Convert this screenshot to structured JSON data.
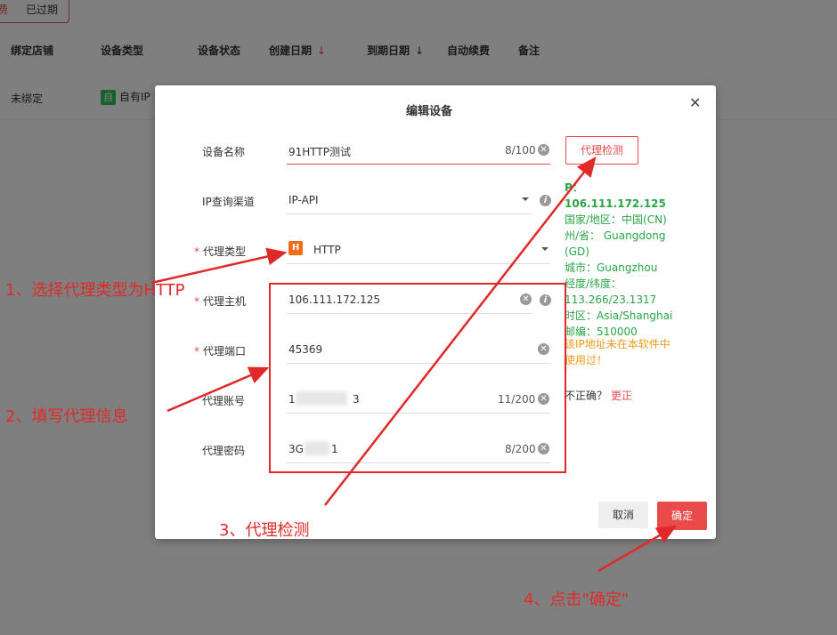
{
  "background": {
    "tabs": [
      "费",
      "已过期"
    ],
    "columns": [
      "绑定店铺",
      "设备类型",
      "设备状态",
      "创建日期",
      "到期日期",
      "自动续费",
      "备注"
    ],
    "row": {
      "shop": "未绑定",
      "type_badge": "自",
      "type_text": "自有IP"
    }
  },
  "modal": {
    "title": "编辑设备",
    "fields": {
      "name": {
        "label": "设备名称",
        "value": "91HTTP测试",
        "count": "8/100"
      },
      "channel": {
        "label": "IP查询渠道",
        "value": "IP-API"
      },
      "proxy_type": {
        "label": "代理类型",
        "value": "HTTP",
        "badge": "H"
      },
      "host": {
        "label": "代理主机",
        "value": "106.111.172.125"
      },
      "port": {
        "label": "代理端口",
        "value": "45369"
      },
      "account": {
        "label": "代理账号",
        "value_start": "1",
        "value_end": "3",
        "count": "11/200"
      },
      "password": {
        "label": "代理密码",
        "value_start": "3G",
        "value_end": "1",
        "count": "8/200"
      }
    },
    "detect_button": "代理检测",
    "ip_info": {
      "ip": "P：106.111.172.125",
      "country": "国家/地区：中国(CN)",
      "province": "州/省： Guangdong (GD)",
      "city": "城市：Guangzhou",
      "coords": "经度/纬度：113.266/23.1317",
      "timezone": "时区：Asia/Shanghai",
      "postal": "邮编：510000"
    },
    "warning": "该IP地址未在本软件中使用过！",
    "incorrect_text": "不正确？",
    "fix_link": "更正",
    "cancel_button": "取消",
    "confirm_button": "确定"
  },
  "annotations": {
    "step1": "1、选择代理类型为HTTP",
    "step2": "2、填写代理信息",
    "step3": "3、代理检测",
    "step4": "4、点击\"确定\""
  },
  "colors": {
    "accent": "#e94b4b",
    "success": "#2aa548",
    "warning": "#f19a1b",
    "badge_orange": "#f26b16",
    "badge_green": "#2ec35f"
  }
}
